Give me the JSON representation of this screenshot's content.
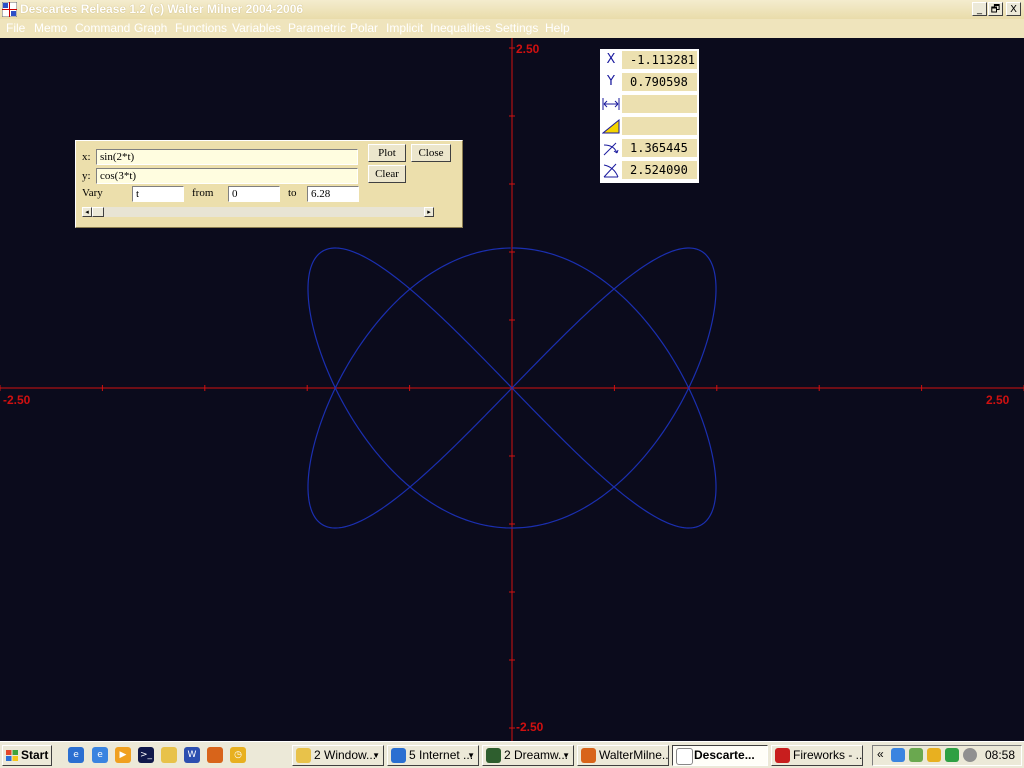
{
  "window": {
    "title": "Descartes Release 1.2 (c) Walter Milner 2004-2006",
    "buttons": {
      "minimize": "_",
      "maximize": "🗗",
      "close": "X"
    }
  },
  "menu": [
    "File",
    "Memo",
    "Command",
    "Graph",
    "Functions",
    "Variables",
    "Parametric",
    "Polar",
    "Implicit",
    "Inequalities",
    "Settings",
    "Help"
  ],
  "plot": {
    "xmin": -2.5,
    "xmax": 2.5,
    "ymin": -2.5,
    "ymax": 2.5,
    "labels": {
      "top": "2.50",
      "bottom": "-2.50",
      "left": "-2.50",
      "right": "2.50"
    },
    "axis_color": "#d01010",
    "curve_color": "#1b2fb0",
    "background": "#0b0b1c",
    "x_expression": "sin(2*t)",
    "y_expression": "cos(3*t)",
    "t_from": 0,
    "t_to": 6.28
  },
  "param_dialog": {
    "x_label": "x:",
    "x_value": "sin(2*t)",
    "y_label": "y:",
    "y_value": "cos(3*t)",
    "vary_label": "Vary",
    "vary_value": "t",
    "from_label": "from",
    "from_value": "0",
    "to_label": "to",
    "to_value": "6.28",
    "plot_button": "Plot",
    "close_button": "Close",
    "clear_button": "Clear",
    "scroll_left": "◂",
    "scroll_right": "▸"
  },
  "coords": {
    "x_label": "X",
    "x_value": "-1.113281",
    "y_label": "Y",
    "y_value": "0.790598",
    "width_icon": "width-icon",
    "width_value": "",
    "area_icon": "triangle-icon",
    "area_value": "",
    "angle_value": "1.365445",
    "angle2_value": "2.524090"
  },
  "taskbar": {
    "start": "Start",
    "tasks": [
      {
        "label": "2 Window...",
        "icon": "folder-icon",
        "color": "#e8c24a"
      },
      {
        "label": "5 Internet ...",
        "icon": "ie-icon",
        "color": "#2b6fd1"
      },
      {
        "label": "2 Dreamw...",
        "icon": "dreamweaver-icon",
        "color": "#2e5e2e"
      },
      {
        "label": "WalterMilne...",
        "icon": "firefox-icon",
        "color": "#d8641a"
      },
      {
        "label": "Descarte...",
        "icon": "descartes-icon",
        "color": "#c03030",
        "active": true
      },
      {
        "label": "Fireworks - ...",
        "icon": "fireworks-icon",
        "color": "#c81e1e"
      }
    ],
    "clock": "08:58",
    "tray_chevron": "«"
  }
}
